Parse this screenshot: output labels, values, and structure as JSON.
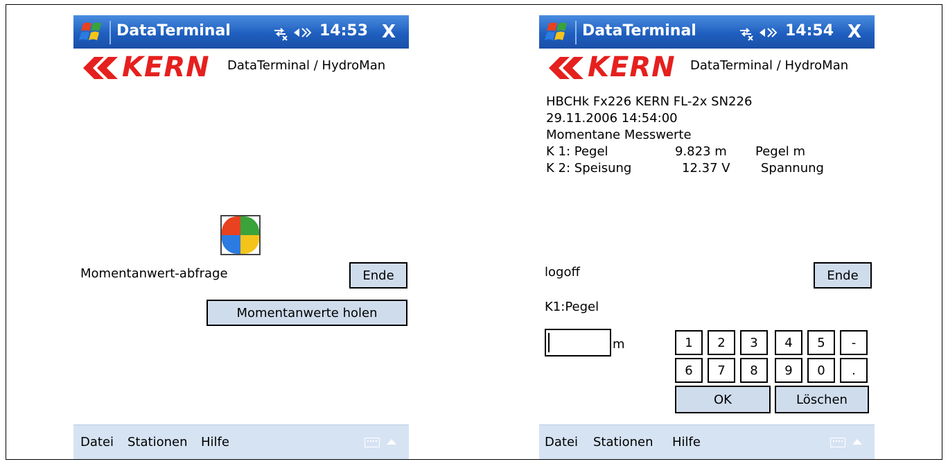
{
  "title_icon": "windows-flag-icon",
  "screens": [
    {
      "title": "DataTerminal",
      "time": "14:53",
      "close": "X",
      "logo_text": "KERN",
      "app_label": "DataTerminal / HydroMan",
      "program_icon": "windows-colorful-program-icon",
      "label": "Momentanwert-abfrage",
      "end_button": "Ende",
      "fetch_button": "Momentanwerte holen",
      "menu": [
        "Datei",
        "Stationen",
        "Hilfe"
      ]
    },
    {
      "title": "DataTerminal",
      "time": "14:54",
      "close": "X",
      "logo_text": "KERN",
      "app_label": "DataTerminal / HydroMan",
      "info_lines": [
        "HBCHk  Fx226  KERN FL-2x SN226",
        "29.11.2006 14:54:00",
        "Momentane Messwerte"
      ],
      "readings": [
        {
          "channel": "K 1: Pegel",
          "value": "9.823 m",
          "desc": "Pegel m"
        },
        {
          "channel": "K 2: Speisung",
          "value": "12.37 V",
          "desc": "Spannung"
        }
      ],
      "logoff": "logoff",
      "end_button": "Ende",
      "input_label": "K1:Pegel",
      "input_value": "",
      "unit": "m",
      "keypad_row1": [
        "1",
        "2",
        "3",
        "4",
        "5",
        "-"
      ],
      "keypad_row2": [
        "6",
        "7",
        "8",
        "9",
        "0",
        "."
      ],
      "ok_button": "OK",
      "delete_button": "Löschen",
      "menu": [
        "Datei",
        "Stationen",
        "Hilfe"
      ]
    }
  ]
}
